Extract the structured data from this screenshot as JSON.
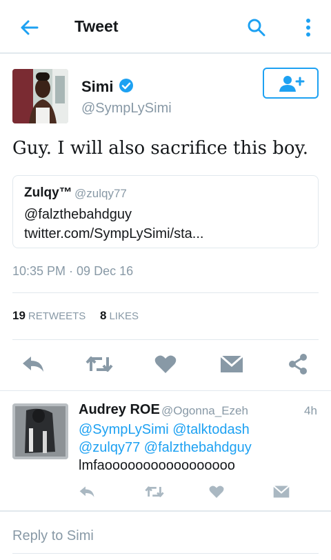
{
  "header": {
    "title": "Tweet",
    "back_icon": "arrow-left-icon",
    "search_icon": "search-icon",
    "more_icon": "more-vertical-icon"
  },
  "tweet": {
    "author_name": "Simi",
    "author_handle": "@SympLySimi",
    "verified": true,
    "text": "Guy. I will also sacrifice this boy.",
    "quoted": {
      "name": "Zulqy™",
      "handle": "@zulqy77",
      "text": "@falzthebahdguy twitter.com/SympLySimi/sta..."
    },
    "timestamp": "10:35 PM · 09 Dec 16",
    "retweets_count": "19",
    "retweets_label": "RETWEETS",
    "likes_count": "8",
    "likes_label": "LIKES"
  },
  "reply": {
    "name": "Audrey ROE",
    "handle": "@Ogonna_Ezeh",
    "time": "4h",
    "mentions_line1": "@SympLySimi @talktodash",
    "mentions_line2": "@zulqy77 @falzthebahdguy",
    "text": "lmfaooooooooooooooooo"
  },
  "reply_box": {
    "placeholder": "Reply to Simi"
  },
  "colors": {
    "accent": "#1da1f2",
    "icon_gray": "#8899a6",
    "divider": "#e1e8ed"
  }
}
